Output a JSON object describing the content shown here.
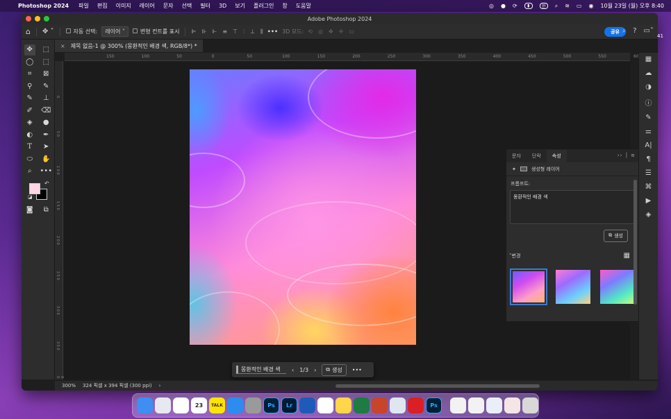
{
  "menubar": {
    "app_name": "Photoshop 2024",
    "menus": [
      "파일",
      "편집",
      "이미지",
      "레이어",
      "문자",
      "선택",
      "필터",
      "3D",
      "보기",
      "플러그인",
      "창",
      "도움말"
    ],
    "status_icons": [
      "creative-cloud-icon",
      "chat-icon",
      "sync-icon",
      "battery-icon",
      "input-korean-icon",
      "search-icon",
      "wifi-icon",
      "control-center-icon",
      "siri-icon"
    ],
    "ime_label": "한",
    "clock": "10월 23일 (월) 오후 8:40"
  },
  "window": {
    "title": "Adobe Photoshop 2024"
  },
  "options_bar": {
    "auto_select_label": "자동 선택:",
    "auto_select_value": "레이어",
    "transform_controls_label": "변형 컨트롤 표시",
    "mode_3d_label": "3D 모드:",
    "share_label": "공유"
  },
  "document_tab": {
    "title": "제목 없음-1 @ 300% (몽환적인 배경 색, RGB/8*) *",
    "close": "×"
  },
  "ruler": {
    "h_ticks": [
      "150",
      "100",
      "50",
      "0",
      "50",
      "100",
      "150",
      "200",
      "250",
      "300",
      "350",
      "400",
      "450",
      "500",
      "550",
      "600"
    ],
    "v_ticks": [
      "0",
      "5 0",
      "1 0 0",
      "1 5 0",
      "2 0 0",
      "2 5 0",
      "3 0 0",
      "3 5 0",
      "4 0 0"
    ]
  },
  "context_bar": {
    "prompt": "몽환적인 배경 색",
    "pager": "1/3",
    "generate_label": "생성",
    "more": "•••"
  },
  "status_bar": {
    "zoom": "300%",
    "doc_info": "324 픽셀 x 394 픽셀 (300 ppi)"
  },
  "properties_panel": {
    "tabs": [
      "문자",
      "단락",
      "속성"
    ],
    "active_tab": "속성",
    "expand": "››",
    "layer_type": "생성형 레이어",
    "prompt_label": "프롬프트:",
    "prompt_value": "몽환적인 배경 색",
    "generate_label": "생성",
    "variations_label": "변경",
    "variations": [
      {
        "selected": true,
        "colors": [
          "#6c5cff",
          "#d04cf0",
          "#ff9fc8",
          "#ffb36b"
        ]
      },
      {
        "selected": false,
        "colors": [
          "#ff7bd6",
          "#9b6bff",
          "#6bd0ff",
          "#ffd27a"
        ]
      },
      {
        "selected": false,
        "colors": [
          "#ff5ac8",
          "#7d7bff",
          "#52e6c6",
          "#c6ff7a"
        ]
      }
    ]
  },
  "right_strip_icons": [
    "grid-icon",
    "cloud-icon",
    "adjust-icon",
    "info-icon",
    "brush-icon",
    "sliders-icon",
    "type-icon",
    "paragraph-icon",
    "properties-icon",
    "paths-icon",
    "play-icon",
    "layers-icon"
  ],
  "right_strip_text": {
    "type": "A|",
    "paragraph": "¶"
  },
  "side_peek": "41",
  "dock": {
    "calendar_day": "23",
    "kakao_label": "TALK",
    "items": [
      {
        "name": "finder-icon",
        "color": "#3f8ef2",
        "label": ""
      },
      {
        "name": "launchpad-icon",
        "color": "#e8e8f0",
        "label": ""
      },
      {
        "name": "chrome-icon",
        "color": "#ffffff",
        "label": ""
      },
      {
        "name": "calendar-icon",
        "color": "#ffffff",
        "label": ""
      },
      {
        "name": "kakaotalk-icon",
        "color": "#fee500",
        "label": ""
      },
      {
        "name": "app-store-icon",
        "color": "#2d8cf0",
        "label": ""
      },
      {
        "name": "system-settings-icon",
        "color": "#9a9a9a",
        "label": ""
      },
      {
        "name": "photoshop-icon",
        "color": "#001e36",
        "label": "Ps"
      },
      {
        "name": "lightroom-icon",
        "color": "#001a33",
        "label": "Lr"
      },
      {
        "name": "word-icon",
        "color": "#1e5bb8",
        "label": ""
      },
      {
        "name": "notion-icon",
        "color": "#ffffff",
        "label": ""
      },
      {
        "name": "notes-icon",
        "color": "#ffd54a",
        "label": ""
      },
      {
        "name": "excel-icon",
        "color": "#1f7a43",
        "label": ""
      },
      {
        "name": "powerpoint-icon",
        "color": "#c8442a",
        "label": ""
      },
      {
        "name": "preview-icon",
        "color": "#dfe6f0",
        "label": ""
      },
      {
        "name": "creative-cloud-app-icon",
        "color": "#da1f26",
        "label": ""
      },
      {
        "name": "photoshop-running-icon",
        "color": "#001e36",
        "label": "Ps"
      }
    ],
    "recent": [
      {
        "name": "recent-doc-1-icon",
        "color": "#f2f2f2"
      },
      {
        "name": "recent-doc-2-icon",
        "color": "#f2f2f2"
      },
      {
        "name": "recent-doc-3-icon",
        "color": "#e9eef8"
      },
      {
        "name": "recent-doc-4-icon",
        "color": "#f5e6e6"
      },
      {
        "name": "trash-icon",
        "color": "#d8d8d8"
      }
    ]
  }
}
